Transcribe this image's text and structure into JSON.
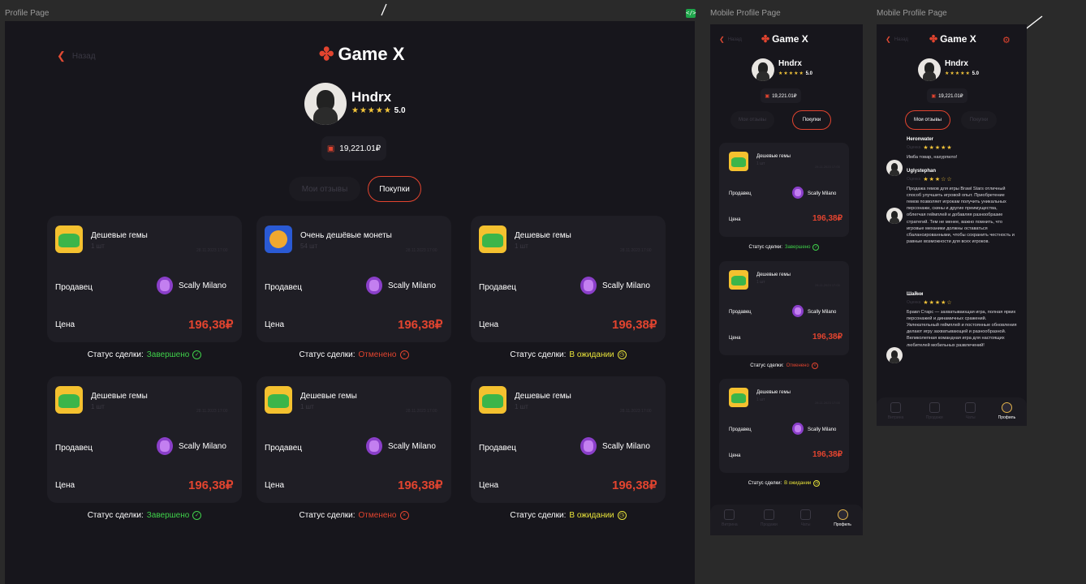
{
  "frames": {
    "desktop_label": "Profile Page",
    "mobile1_label": "Mobile Profile Page",
    "mobile2_label": "Mobile Profile Page",
    "badge_icon": "</>"
  },
  "common": {
    "back": "Назад",
    "logo": "Game X",
    "user": "Hndrx",
    "stars": "★★★★★",
    "rating": "5.0",
    "balance": "19,221.01₽",
    "tab_reviews": "Мои отзывы",
    "tab_purchases": "Покупки",
    "seller_label": "Продавец",
    "price_label": "Цена",
    "status_label": "Статус сделки:",
    "seller_name": "Scally Milano",
    "price": "196,38₽"
  },
  "desktop_cards": [
    {
      "title": "Дешевые гемы",
      "qty": "1 шт",
      "date": "28.11.2023 17:00",
      "status": "Завершено",
      "status_type": "done",
      "thumb": "gems"
    },
    {
      "title": "Очень дешёвые монеты",
      "qty": "54 шт",
      "date": "28.11.2023 17:00",
      "status": "Отменено",
      "status_type": "cancel",
      "thumb": "coins"
    },
    {
      "title": "Дешевые гемы",
      "qty": "1 шт",
      "date": "28.11.2023 17:00",
      "status": "В ожидании",
      "status_type": "wait",
      "thumb": "gems"
    },
    {
      "title": "Дешевые гемы",
      "qty": "1 шт",
      "date": "28.11.2023 17:00",
      "status": "Завершено",
      "status_type": "done",
      "thumb": "gems"
    },
    {
      "title": "Дешевые гемы",
      "qty": "1 шт",
      "date": "28.11.2023 17:00",
      "status": "Отменено",
      "status_type": "cancel",
      "thumb": "gems"
    },
    {
      "title": "Дешевые гемы",
      "qty": "1 шт",
      "date": "28.11.2023 17:00",
      "status": "В ожидании",
      "status_type": "wait",
      "thumb": "gems"
    }
  ],
  "mobile_cards": [
    {
      "title": "Дешевые гемы",
      "qty": "1 шт",
      "date": "28.11.2023 17:00",
      "status": "Завершено",
      "status_type": "done"
    },
    {
      "title": "Дешевые гемы",
      "qty": "1 шт",
      "date": "28.11.2023 17:00",
      "status": "Отменено",
      "status_type": "cancel"
    },
    {
      "title": "Дешевые гемы",
      "qty": "1 шт",
      "date": "28.11.2023 17:00",
      "status": "В ожидании",
      "status_type": "wait"
    }
  ],
  "tabbar": [
    {
      "label": "Витрина",
      "icon": "grid-icon"
    },
    {
      "label": "Продажи",
      "icon": "plus-circle-icon"
    },
    {
      "label": "Чаты",
      "icon": "chat-icon"
    },
    {
      "label": "Профиль",
      "icon": "avatar-icon"
    }
  ],
  "reviews": [
    {
      "name": "Heronwater",
      "sub": "Оценка",
      "stars": "★★★★★",
      "text": "Имба товар, нахурпило!"
    },
    {
      "name": "Uglystephan",
      "sub": "Оценка",
      "stars": "★★★☆☆",
      "text": "Продажа гемов для игры Brawl Stars отличный способ улучшить игровой опыт. Приобретение гемов позволяет игрокам получить уникальных персонажи, скины и другие преимущества, облегчая геймплей и добавляя разнообразие стратегий. Тем не менее, важно помнить, что игровые механики должны оставаться сбалансированными, чтобы сохранить честность и равные возможности для всех игроков."
    },
    {
      "name": "Шайни",
      "sub": "Оценка",
      "stars": "★★★★☆",
      "text": "Бравл Старс — захватывающая игра, полная ярких персонажей и динамичных сражений. Увлекательный геймплей и постоянные обновления делают игру захватывающей и разнообразной. Великолепная командная игра для настоящих любителей мобильных развлечений!"
    }
  ],
  "colors": {
    "accent": "#e2442f",
    "done": "#3fd14a",
    "wait": "#e8e33a",
    "bg": "#17161c",
    "card": "#1f1e25"
  }
}
